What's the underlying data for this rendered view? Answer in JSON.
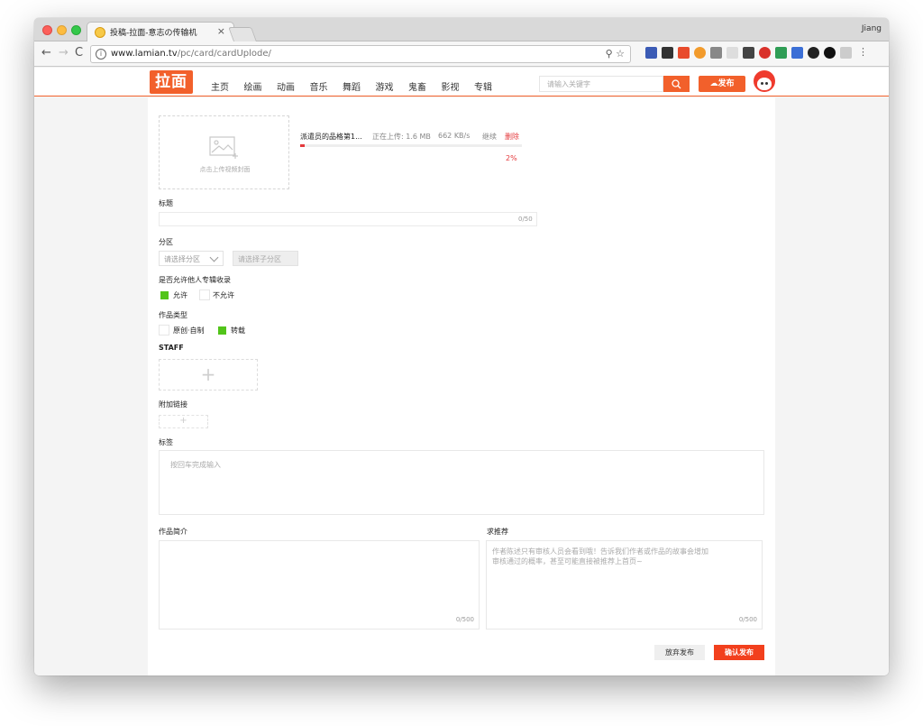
{
  "browser": {
    "tab_title": "投稿-拉面-意志の传输机",
    "tab_close": "×",
    "profile_name": "Jiang",
    "url_host": "www.lamian.tv",
    "url_path": "/pc/card/cardUplode/"
  },
  "header": {
    "logo_text": "拉面",
    "nav": [
      "主页",
      "绘画",
      "动画",
      "音乐",
      "舞蹈",
      "游戏",
      "鬼畜",
      "影视",
      "专辑"
    ],
    "search_placeholder": "请输入关键字",
    "publish_label": "发布"
  },
  "upload": {
    "cover_label": "点击上传视频封面",
    "file_name": "派遣员的品格第1...",
    "status": "正在上传: 1.6 MB",
    "speed": "662 KB/s",
    "resume_label": "继续",
    "delete_label": "删除",
    "progress_percent": 2,
    "progress_text": "2%"
  },
  "form": {
    "title_label": "标题",
    "title_counter": "0/50",
    "section_label": "分区",
    "section_placeholder": "请选择分区",
    "subsection_placeholder": "请选择子分区",
    "allow_label": "是否允许他人专辑收录",
    "allow_options": [
      {
        "label": "允许",
        "checked": true
      },
      {
        "label": "不允许",
        "checked": false
      }
    ],
    "type_label": "作品类型",
    "type_options": [
      {
        "label": "原创·自制",
        "checked": false
      },
      {
        "label": "转载",
        "checked": true
      }
    ],
    "staff_label": "STAFF",
    "staff_add": "+",
    "link_label": "附加链接",
    "link_add": "+",
    "tags_label": "标签",
    "tags_placeholder": "按回车完成输入",
    "intro_label": "作品简介",
    "intro_counter": "0/500",
    "recommend_label": "求推荐",
    "recommend_placeholder_line1": "作者陈述只有审核人员会看到哦！告诉我们作者或作品的故事会增加",
    "recommend_placeholder_line2": "审核通过的概率，甚至可能直接被推荐上首页~",
    "recommend_counter": "0/500",
    "cancel_label": "放弃发布",
    "confirm_label": "确认发布"
  },
  "colors": {
    "brand": "#f2602b",
    "danger": "#e4393c",
    "checked": "#52c41a"
  }
}
